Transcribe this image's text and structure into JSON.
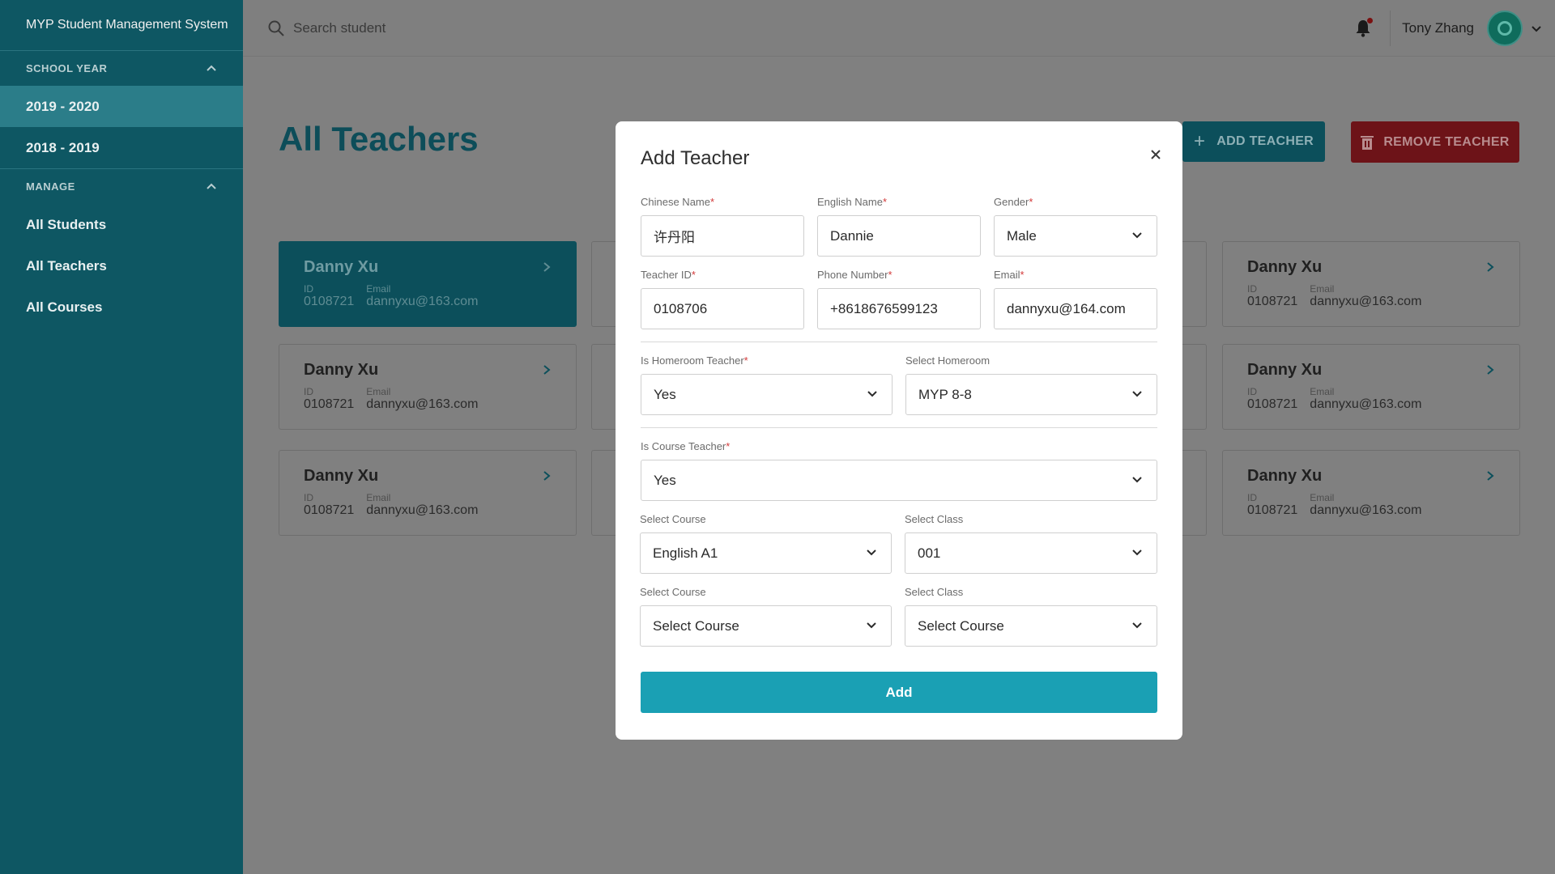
{
  "app": {
    "title": "MYP Student Management System"
  },
  "sidebar": {
    "school_year_label": "SCHOOL YEAR",
    "years": [
      "2019 - 2020",
      "2018 - 2019"
    ],
    "manage_label": "MANAGE",
    "manage_items": [
      "All Students",
      "All Teachers",
      "All Courses"
    ]
  },
  "topbar": {
    "search_placeholder": "Search student",
    "user_name": "Tony Zhang"
  },
  "page": {
    "title": "All Teachers",
    "add_teacher_label": "ADD TEACHER",
    "remove_teacher_label": "REMOVE TEACHER"
  },
  "card": {
    "name": "Danny Xu",
    "id_label": "ID",
    "id_value": "0108721",
    "email_label": "Email",
    "email_value": "dannyxu@163.com"
  },
  "modal": {
    "title": "Add Teacher",
    "chinese_name_label": "Chinese Name",
    "chinese_name_value": "许丹阳",
    "english_name_label": "English Name",
    "english_name_value": "Dannie",
    "gender_label": "Gender",
    "gender_value": "Male",
    "teacher_id_label": "Teacher ID",
    "teacher_id_value": "0108706",
    "phone_label": "Phone Number",
    "phone_value": "+8618676599123",
    "email_label": "Email",
    "email_value": "dannyxu@164.com",
    "is_homeroom_label": "Is Homeroom Teacher",
    "is_homeroom_value": "Yes",
    "select_homeroom_label": "Select Homeroom",
    "select_homeroom_value": "MYP 8-8",
    "is_course_label": "Is Course Teacher",
    "is_course_value": "Yes",
    "select_course_label": "Select Course",
    "select_class_label": "Select Class",
    "course1_value": "English A1",
    "class1_value": "001",
    "course2_value": "Select Course",
    "class2_value": "Select Course",
    "required_mark": "*",
    "add_button": "Add"
  },
  "colors": {
    "sidebar": "#0e5763",
    "accent": "#1aa0b4",
    "danger": "#6d1318"
  }
}
